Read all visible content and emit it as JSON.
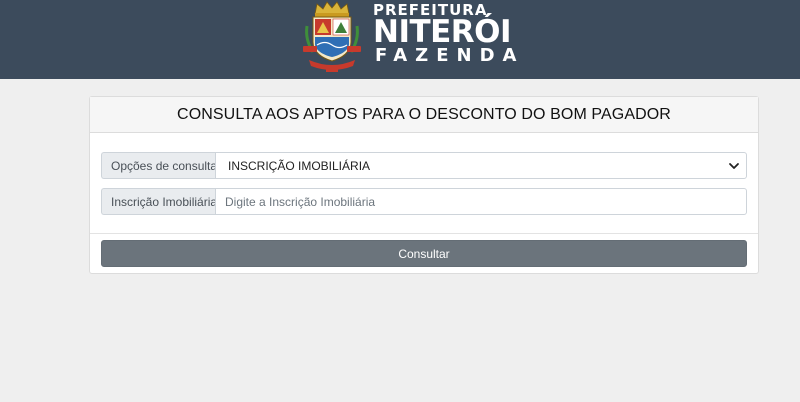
{
  "header": {
    "brand_line1": "PREFEITURA",
    "brand_line2": "NITERÓI",
    "brand_line3": "FAZENDA",
    "colors": {
      "background": "#3c4b5c",
      "text": "#ffffff"
    }
  },
  "card": {
    "title": "CONSULTA AOS APTOS PARA O DESCONTO DO BOM PAGADOR",
    "options_label": "Opções de consulta",
    "options_selected": "INSCRIÇÃO IMOBILIÁRIA",
    "inscricao_label": "Inscrição Imobiliária",
    "inscricao_value": "",
    "inscricao_placeholder": "Digite a Inscrição Imobiliária",
    "submit_label": "Consultar",
    "colors": {
      "button": "#6b747c",
      "page_bg": "#efefef"
    }
  },
  "icons": {
    "logo": "niteroi-coat-of-arms-icon",
    "select_arrow": "chevron-down-icon"
  }
}
